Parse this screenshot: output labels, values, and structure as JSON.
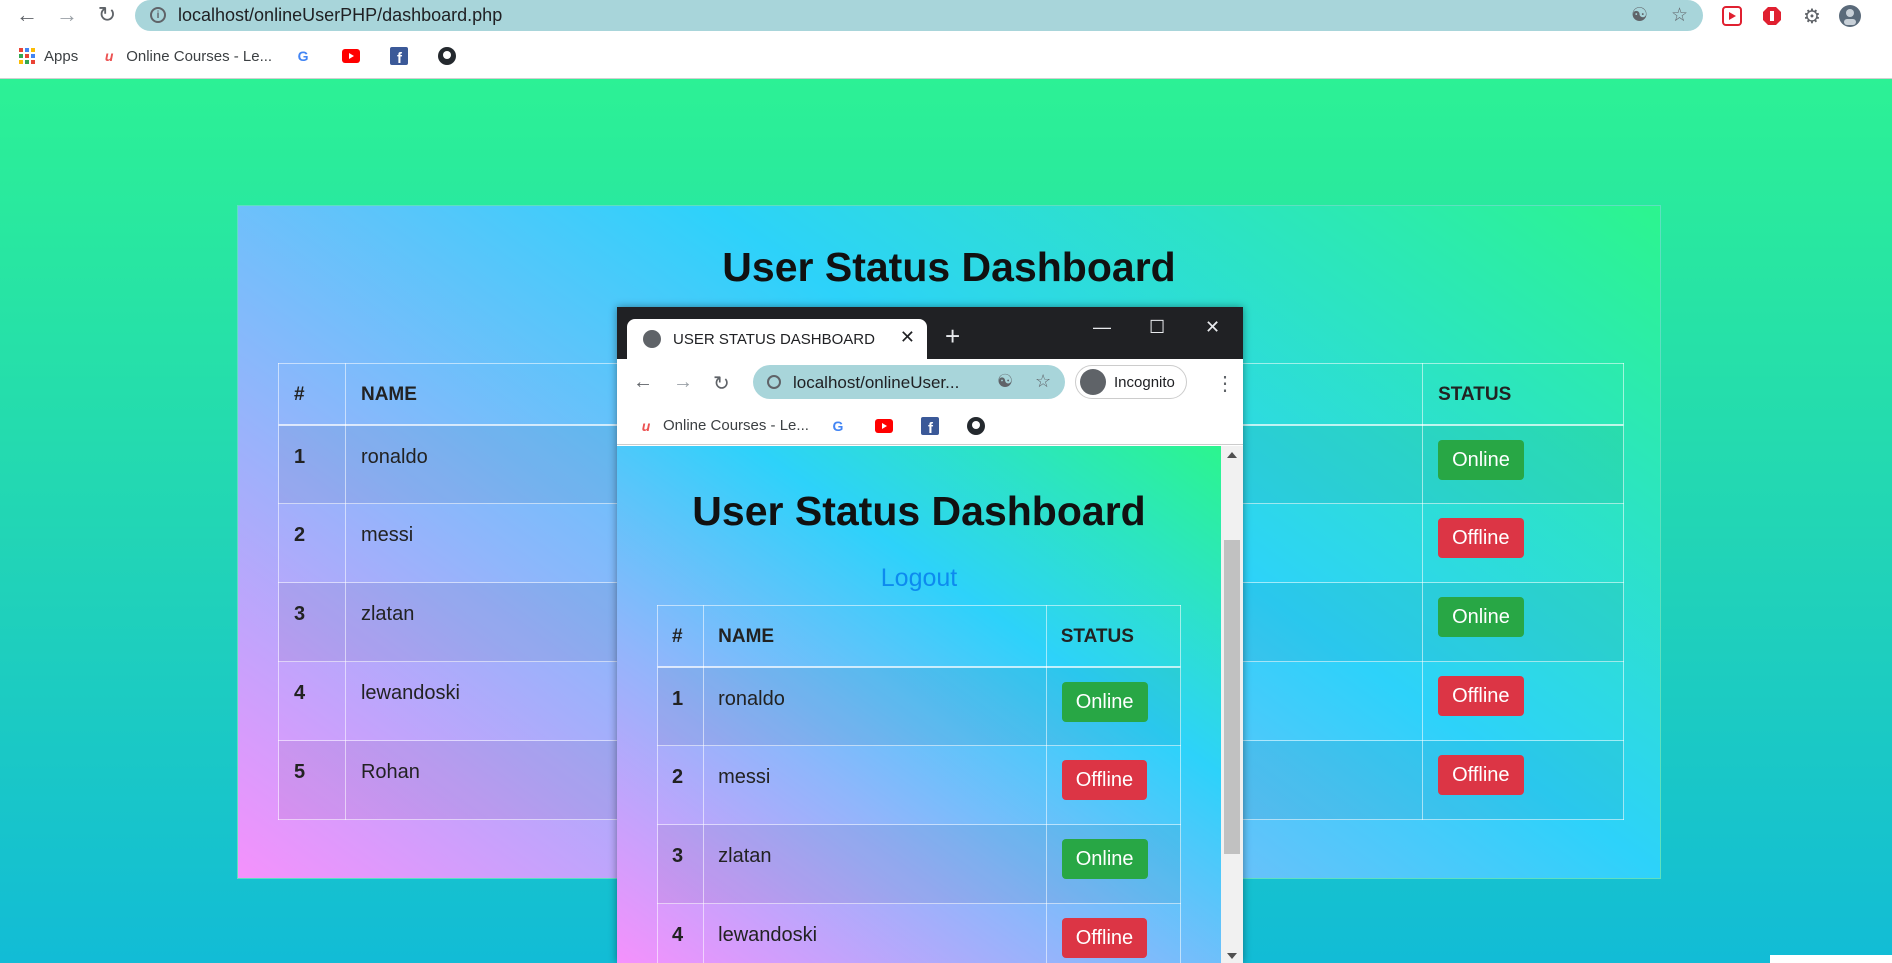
{
  "browser": {
    "url": "localhost/onlineUserPHP/dashboard.php",
    "bookmarks": [
      {
        "label": "Apps",
        "icon": "apps-grid-icon"
      },
      {
        "label": "Online Courses - Le...",
        "icon": "udemy-icon"
      },
      {
        "label": "",
        "icon": "google-icon"
      },
      {
        "label": "",
        "icon": "youtube-icon"
      },
      {
        "label": "",
        "icon": "facebook-icon"
      },
      {
        "label": "",
        "icon": "github-icon"
      }
    ]
  },
  "dashboard": {
    "title": "User Status Dashboard",
    "columns": [
      "#",
      "NAME",
      "STATUS"
    ],
    "rows": [
      {
        "num": "1",
        "name": "ronaldo",
        "status": "Online"
      },
      {
        "num": "2",
        "name": "messi",
        "status": "Offline"
      },
      {
        "num": "3",
        "name": "zlatan",
        "status": "Online"
      },
      {
        "num": "4",
        "name": "lewandoski",
        "status": "Offline"
      },
      {
        "num": "5",
        "name": "Rohan",
        "status": "Offline"
      }
    ]
  },
  "popup": {
    "tab_title": "USER STATUS DASHBOARD",
    "url": "localhost/onlineUser...",
    "incognito_label": "Incognito",
    "bookmark_label": "Online Courses - Le...",
    "page_title": "User Status Dashboard",
    "logout_label": "Logout",
    "columns": [
      "#",
      "NAME",
      "STATUS"
    ],
    "rows": [
      {
        "num": "1",
        "name": "ronaldo",
        "status": "Online"
      },
      {
        "num": "2",
        "name": "messi",
        "status": "Offline"
      },
      {
        "num": "3",
        "name": "zlatan",
        "status": "Online"
      },
      {
        "num": "4",
        "name": "lewandoski",
        "status": "Offline"
      }
    ]
  },
  "colors": {
    "online": "#28a745",
    "offline": "#dc3545",
    "omnibox": "#a8d5da",
    "logout_link": "#0d8aef"
  }
}
